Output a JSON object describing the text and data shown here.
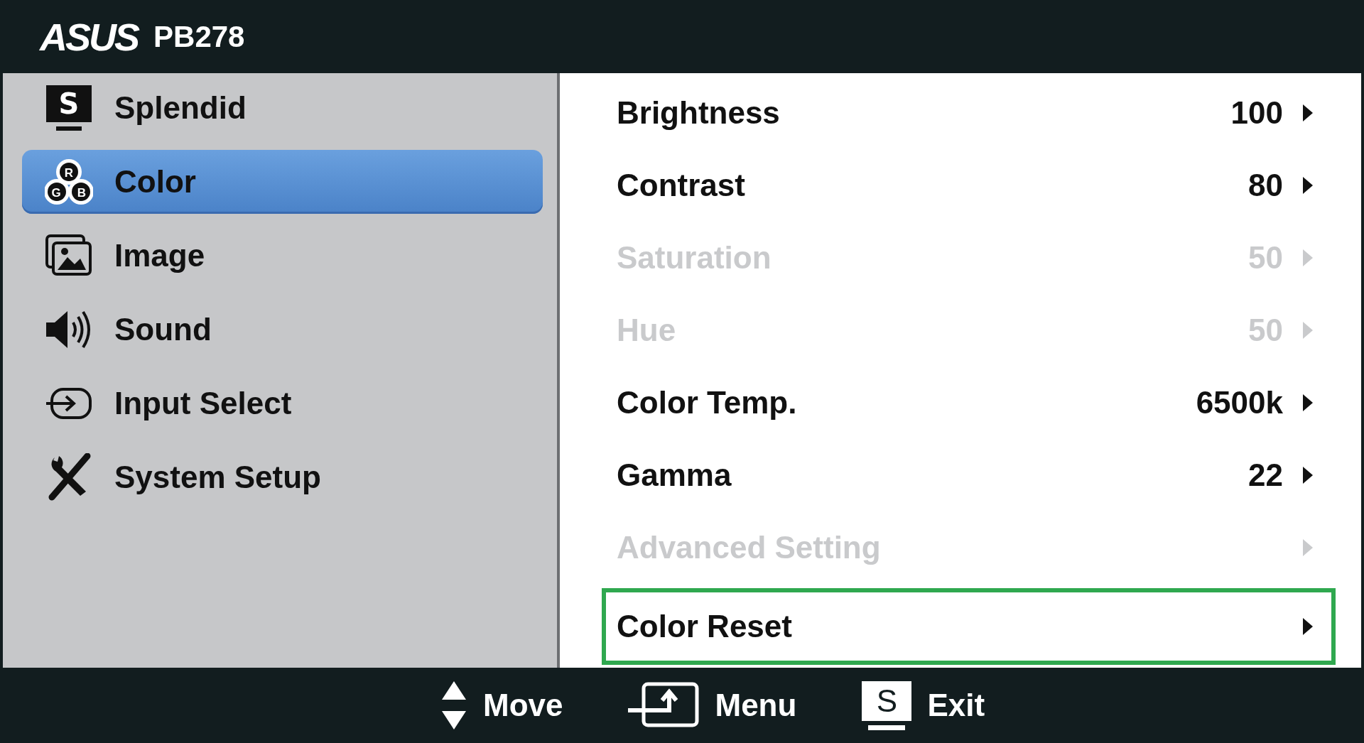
{
  "header": {
    "brand": "ASUS",
    "model": "PB278"
  },
  "sidebar": {
    "items": [
      {
        "label": "Splendid",
        "kind": "splendid",
        "icon_letter": "S",
        "selected": false
      },
      {
        "label": "Color",
        "kind": "color",
        "icon_letters": [
          "R",
          "G",
          "B"
        ],
        "selected": true
      },
      {
        "label": "Image",
        "kind": "image",
        "selected": false
      },
      {
        "label": "Sound",
        "kind": "sound",
        "selected": false
      },
      {
        "label": "Input Select",
        "kind": "input",
        "selected": false
      },
      {
        "label": "System Setup",
        "kind": "setup",
        "selected": false
      }
    ]
  },
  "settings": [
    {
      "label": "Brightness",
      "value": "100",
      "disabled": false,
      "selected": false
    },
    {
      "label": "Contrast",
      "value": "80",
      "disabled": false,
      "selected": false
    },
    {
      "label": "Saturation",
      "value": "50",
      "disabled": true,
      "selected": false
    },
    {
      "label": "Hue",
      "value": "50",
      "disabled": true,
      "selected": false
    },
    {
      "label": "Color Temp.",
      "value": "6500k",
      "disabled": false,
      "selected": false
    },
    {
      "label": "Gamma",
      "value": "22",
      "disabled": false,
      "selected": false
    },
    {
      "label": "Advanced Setting",
      "disabled": true,
      "selected": false
    },
    {
      "label": "Color Reset",
      "disabled": false,
      "selected": true
    }
  ],
  "footer": [
    {
      "kind": "move",
      "label": "Move"
    },
    {
      "kind": "menu",
      "label": "Menu"
    },
    {
      "kind": "exit",
      "label": "Exit",
      "key_letter": "S"
    }
  ]
}
